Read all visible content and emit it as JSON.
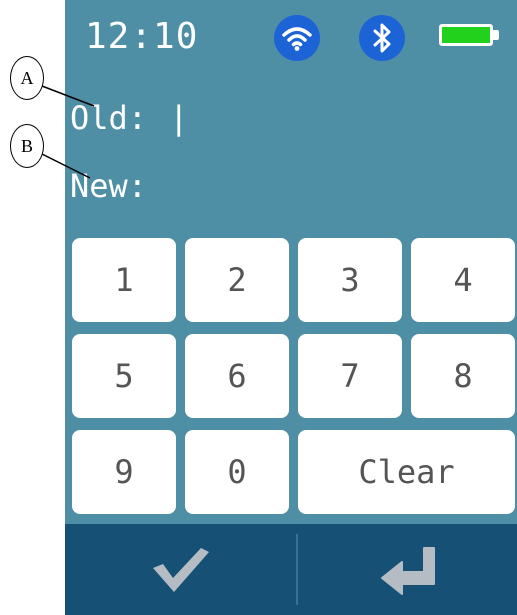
{
  "status_bar": {
    "time": "12:10",
    "icons": [
      "wifi-icon",
      "bluetooth-icon",
      "battery-full-icon"
    ]
  },
  "fields": {
    "old_label": "Old:",
    "old_value": "|",
    "new_label": "New:",
    "new_value": ""
  },
  "keypad": {
    "keys": [
      "1",
      "2",
      "3",
      "4",
      "5",
      "6",
      "7",
      "8",
      "9",
      "0",
      "Clear"
    ]
  },
  "bottom_bar": {
    "left_icon": "checkmark-icon",
    "right_icon": "enter-return-icon"
  },
  "annotations": {
    "a": "A",
    "b": "B"
  },
  "colors": {
    "screen_bg": "#4f8fa6",
    "bottom_bar_bg": "#175075",
    "icon_circle": "#1c63d6",
    "battery_fill": "#22d11b",
    "key_bg": "#ffffff",
    "key_text": "#555555"
  }
}
